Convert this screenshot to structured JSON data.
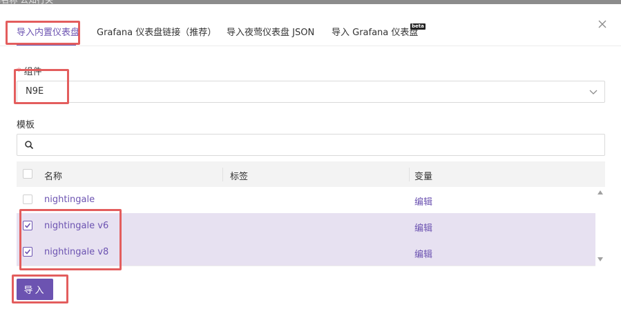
{
  "background_hint": {
    "text": "i名称  公知行关"
  },
  "tabs": [
    {
      "label": "导入内置仪表盘",
      "active": true
    },
    {
      "label": "Grafana 仪表盘链接（推荐）",
      "active": false
    },
    {
      "label": "导入夜莺仪表盘 JSON",
      "active": false
    },
    {
      "label": "导入 Grafana 仪表盘",
      "active": false,
      "badge": "beta"
    }
  ],
  "form": {
    "component": {
      "required_mark": "*",
      "label": "组件",
      "value": "N9E"
    },
    "template": {
      "label": "模板",
      "search_placeholder": ""
    }
  },
  "table": {
    "columns": {
      "name": "名称",
      "tags": "标签",
      "variables": "变量"
    },
    "rows": [
      {
        "name": "nightingale",
        "tags": "",
        "action": "编辑",
        "checked": false
      },
      {
        "name": "nightingale v6",
        "tags": "",
        "action": "编辑",
        "checked": true
      },
      {
        "name": "nightingale v8",
        "tags": "",
        "action": "编辑",
        "checked": true
      }
    ]
  },
  "import_button": {
    "label": "导入"
  },
  "colors": {
    "accent": "#6c53b1",
    "selected_row": "#e7e1f1",
    "highlight": "#e35d5d"
  }
}
